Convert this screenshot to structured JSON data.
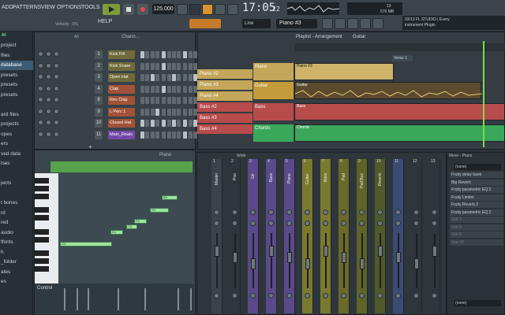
{
  "menu": [
    "ADD",
    "PATTERNS",
    "VIEW",
    "OPTIONS",
    "TOOLS",
    "HELP"
  ],
  "transport": {
    "tempo": "125.000",
    "time": "17:05",
    "time_sub": "22",
    "pattern": "Piano #3",
    "cpu": "13",
    "ram": "576 MB",
    "velocity": "Velocity - 0%"
  },
  "hint": {
    "line1": "03/13 FL STUDIO | Every",
    "line2": "instrument Plugin"
  },
  "browser": {
    "filter": "All",
    "items": [
      "project",
      "files",
      "database",
      "presets",
      "presets",
      "presets",
      "",
      "ard files",
      "projects",
      "opes",
      "ers",
      "ved data",
      "ises",
      "",
      "jects",
      "",
      "t bones",
      "rd",
      "red",
      "audio",
      "ffonts",
      "h",
      "_folder",
      "ates",
      "es"
    ],
    "selected_index": 2
  },
  "rack": {
    "title": "Chann...",
    "filter": "All",
    "channels": [
      {
        "num": "1",
        "name": "Kick Fill",
        "color": "#6e6a3a"
      },
      {
        "num": "2",
        "name": "Kick Snare",
        "color": "#6e6a3a"
      },
      {
        "num": "3",
        "name": "Open Hat",
        "color": "#6e6a3a"
      },
      {
        "num": "4",
        "name": "Clap",
        "color": "#a25238"
      },
      {
        "num": "8",
        "name": "Rev Clap",
        "color": "#a25238"
      },
      {
        "num": "9",
        "name": "L Perc 1",
        "color": "#a25238"
      },
      {
        "num": "10",
        "name": "Closed Hat",
        "color": "#a25238"
      },
      {
        "num": "11",
        "name": "Main_Reals",
        "color": "#7448a8"
      }
    ]
  },
  "playlist": {
    "title": "Playlist - Arrangement",
    "path": "Guitar",
    "marker": "Verse 1",
    "patterns": [
      "Piano #2",
      "Piano #3",
      "Piano #4",
      "Bass #2",
      "Bass #3",
      "Bass #4"
    ],
    "tracks": [
      "Piano",
      "Guitar",
      "Bass",
      "Chords"
    ],
    "clips": {
      "piano": "Piano #3",
      "guitar": "Guitar",
      "bass": "Bass",
      "chords": "Chords"
    }
  },
  "pianoroll": {
    "title": "Piano",
    "control": "Control",
    "notes": [
      "B4",
      "G4",
      "F4",
      "E4",
      "C4",
      "G3"
    ]
  },
  "mixer": {
    "title": "Wide",
    "strips": [
      "Master",
      "Pno",
      "Gtr",
      "Bass",
      "Piano",
      "Guitar",
      "Bass",
      "Pad",
      "Pad Bus",
      "Reverb",
      "",
      "",
      ""
    ],
    "numbers": [
      "1",
      "2",
      "3",
      "4",
      "5",
      "6",
      "7",
      "8",
      "9",
      "10",
      "11",
      "12",
      "13"
    ]
  },
  "inspector": {
    "title": "Mixer - Piano",
    "slot_top": "(none)",
    "slot_bottom": "(none)",
    "fx": [
      {
        "name": "Fruity delay bank",
        "on": true
      },
      {
        "name": "Big Reverb",
        "on": true
      },
      {
        "name": "Fruity parametric EQ 2",
        "on": true
      },
      {
        "name": "Fruity Limiter",
        "on": true
      },
      {
        "name": "Fruity Reverb 2",
        "on": true
      },
      {
        "name": "Fruity parametric EQ 2",
        "on": true
      },
      {
        "name": "Slot 7",
        "on": false
      },
      {
        "name": "Slot 8",
        "on": false
      },
      {
        "name": "Slot 9",
        "on": false
      },
      {
        "name": "Slot 10",
        "on": false
      }
    ]
  },
  "colors": {
    "accent": "#7e9b3c",
    "bass": "#b84b4b",
    "chords": "#3aa75a",
    "guitar": "#c49b3a",
    "piano": "#c4a65a"
  }
}
